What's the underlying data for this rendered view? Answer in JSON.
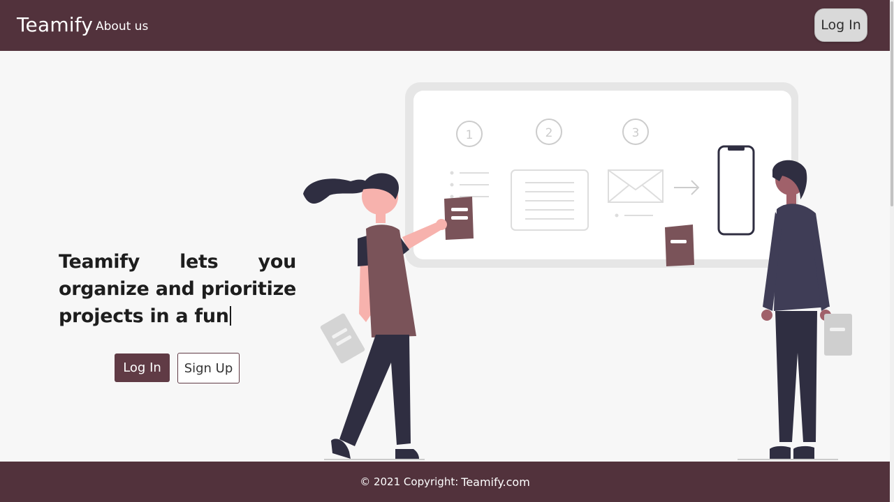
{
  "navbar": {
    "brand": "Teamify",
    "about_link": "About us",
    "login_button": "Log In"
  },
  "hero": {
    "headline": "Teamify lets you organize and prioritize projects in a fun",
    "login_button": "Log In",
    "signup_button": "Sign Up"
  },
  "illustration": {
    "steps": [
      "1",
      "2",
      "3"
    ]
  },
  "footer": {
    "copyright": "© 2021 Copyright:",
    "site_link": "Teamify.com"
  },
  "colors": {
    "brand": "#52323c",
    "accent": "#7a5359",
    "skin": "#f7b2ad",
    "dark": "#2f2e41"
  }
}
